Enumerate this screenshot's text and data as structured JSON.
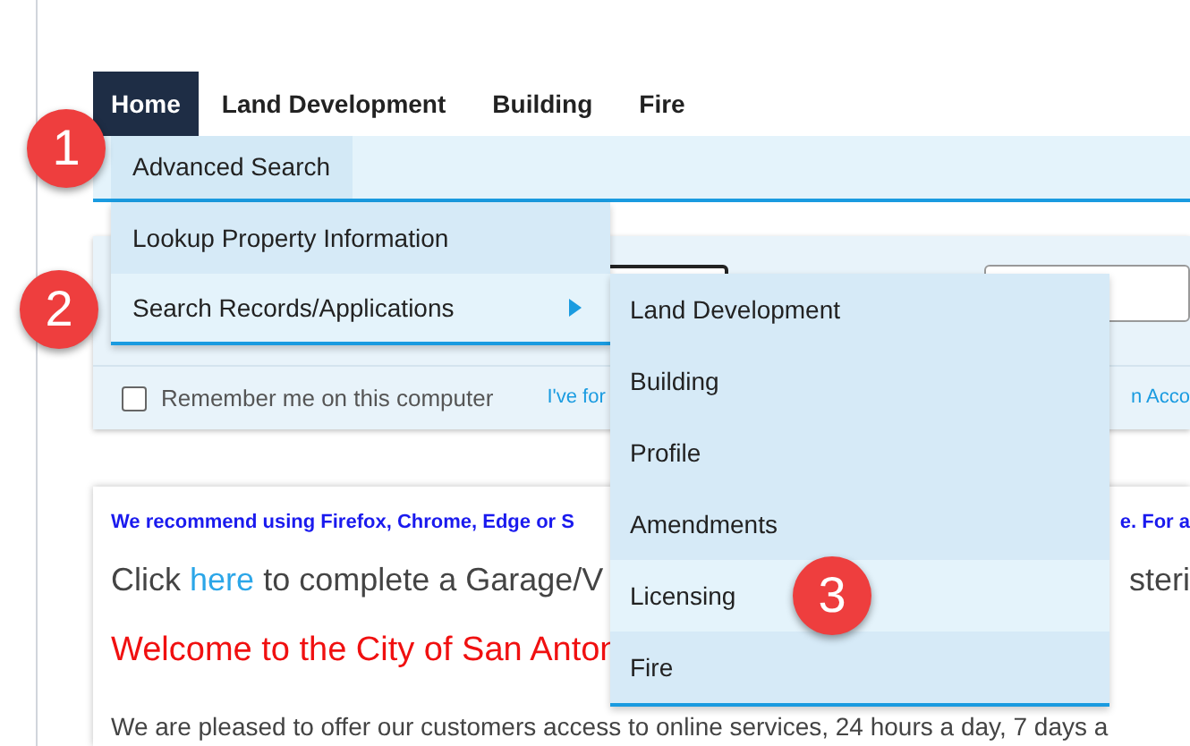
{
  "nav": {
    "tabs": [
      {
        "label": "Home",
        "selected": true
      },
      {
        "label": "Land Development",
        "selected": false
      },
      {
        "label": "Building",
        "selected": false
      },
      {
        "label": "Fire",
        "selected": false
      }
    ]
  },
  "submenu": {
    "items": [
      {
        "label": "Advanced Search",
        "selected": true
      }
    ]
  },
  "dropdown": {
    "items": [
      {
        "label": "Lookup Property Information",
        "selected": false,
        "expanded": false
      },
      {
        "label": "Search Records/Applications",
        "selected": true,
        "expanded": true
      }
    ]
  },
  "flyout": {
    "items": [
      {
        "label": "Land Development",
        "selected": false
      },
      {
        "label": "Building",
        "selected": false
      },
      {
        "label": "Profile",
        "selected": false
      },
      {
        "label": "Amendments",
        "selected": false
      },
      {
        "label": "Licensing",
        "selected": true
      },
      {
        "label": "Fire",
        "selected": false
      }
    ]
  },
  "login": {
    "remember": {
      "label": "Remember me on this computer",
      "checked": false
    },
    "links": [
      "I've for",
      "n Acco"
    ]
  },
  "content": {
    "notice": [
      "We recommend using Firefox, Chrome, Edge or S",
      "e. For a"
    ],
    "click_line": {
      "before": "Click",
      "link": "here",
      "after": "to complete a Garage/V",
      "tail": "steri"
    },
    "welcome": "Welcome to the City of San Anton",
    "intro": "We are pleased to offer our customers access to online services, 24 hours a day, 7 days a"
  },
  "callouts": [
    "1",
    "2",
    "3"
  ]
}
